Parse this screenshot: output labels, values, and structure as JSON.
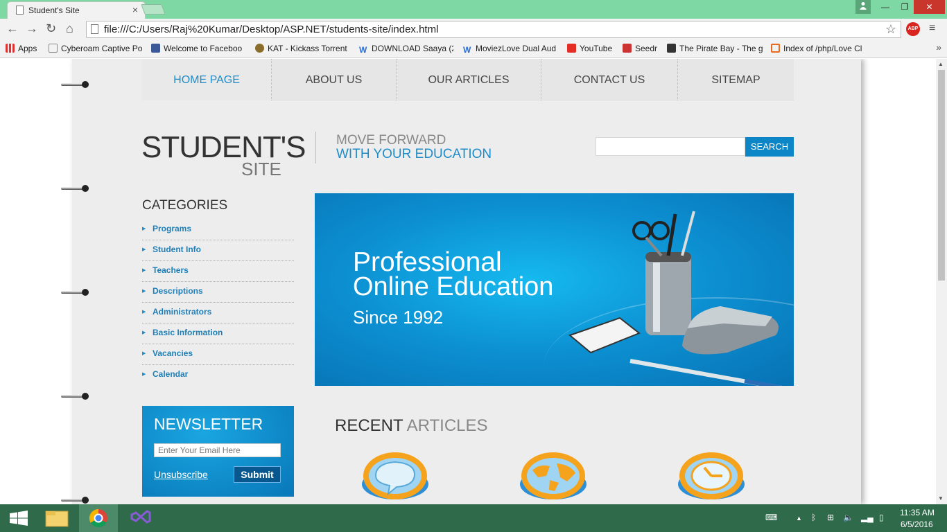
{
  "browser": {
    "tab_title": "Student's Site",
    "tab_close": "×",
    "url": "file:///C:/Users/Raj%20Kumar/Desktop/ASP.NET/students-site/index.html",
    "abp_label": "ABP",
    "window_min": "—",
    "window_max": "❐",
    "window_close": "✕",
    "back": "←",
    "forward": "→",
    "reload": "↻",
    "home": "⌂",
    "star": "☆",
    "menu": "≡",
    "bookmarks_more": "»"
  },
  "bookmarks": [
    {
      "label": "Apps",
      "color": "#d33"
    },
    {
      "label": "Cyberoam Captive Po",
      "color": "#888"
    },
    {
      "label": "Welcome to Faceboo",
      "color": "#3b5998"
    },
    {
      "label": "KAT - Kickass Torrent",
      "color": "#8a6d2b"
    },
    {
      "label": "DOWNLOAD Saaya (2",
      "color": "#2b6cd4"
    },
    {
      "label": "MoviezLove Dual Aud",
      "color": "#2b6cd4"
    },
    {
      "label": "YouTube",
      "color": "#e52d27"
    },
    {
      "label": "Seedr",
      "color": "#c33"
    },
    {
      "label": "The Pirate Bay - The g",
      "color": "#333"
    },
    {
      "label": "Index of /php/Love Cl",
      "color": "#e66a1f"
    }
  ],
  "site": {
    "nav": [
      {
        "label": "HOME PAGE",
        "active": true
      },
      {
        "label": "ABOUT US",
        "active": false
      },
      {
        "label": "OUR ARTICLES",
        "active": false
      },
      {
        "label": "CONTACT US",
        "active": false
      },
      {
        "label": "SITEMAP",
        "active": false
      }
    ],
    "logo_main": "STUDENT'S",
    "logo_sub": "SITE",
    "tagline_1": "MOVE FORWARD",
    "tagline_2": "WITH YOUR EDUCATION",
    "search_button": "SEARCH",
    "search_value": "",
    "categories_title": "CATEGORIES",
    "categories": [
      "Programs",
      "Student Info",
      "Teachers",
      "Descriptions",
      "Administrators",
      "Basic Information",
      "Vacancies",
      "Calendar"
    ],
    "banner": {
      "line1": "Professional",
      "line2": "Online Education",
      "line3": "Since 1992"
    },
    "newsletter": {
      "title": "NEWSLETTER",
      "email_placeholder": "Enter Your Email Here",
      "unsubscribe": "Unsubscribe",
      "submit": "Submit"
    },
    "recent_title_a": "RECENT",
    "recent_title_b": " ARTICLES",
    "recent_icons": [
      "chat-bubble-icon",
      "globe-icon",
      "clock-icon"
    ]
  },
  "taskbar": {
    "time": "11:35 AM",
    "date": "6/5/2016"
  },
  "colors": {
    "accent": "#1e8cc8",
    "titlebar": "#7ed8a4",
    "taskbar": "#2f6b4b"
  }
}
